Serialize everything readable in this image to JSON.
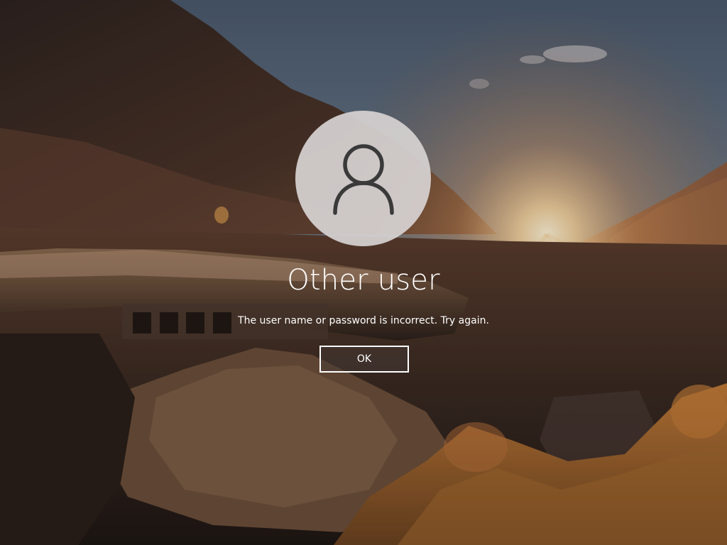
{
  "login": {
    "username": "Other user",
    "error_message": "The user name or password is incorrect. Try again.",
    "ok_label": "OK",
    "avatar_icon": "user-icon"
  },
  "colors": {
    "text": "#ffffff",
    "avatar_bg": "#d6d2d2",
    "avatar_icon": "#3a3a3a",
    "button_border": "#ffffff"
  },
  "background": {
    "scene": "mountain-valley-sunset-wallpaper"
  }
}
